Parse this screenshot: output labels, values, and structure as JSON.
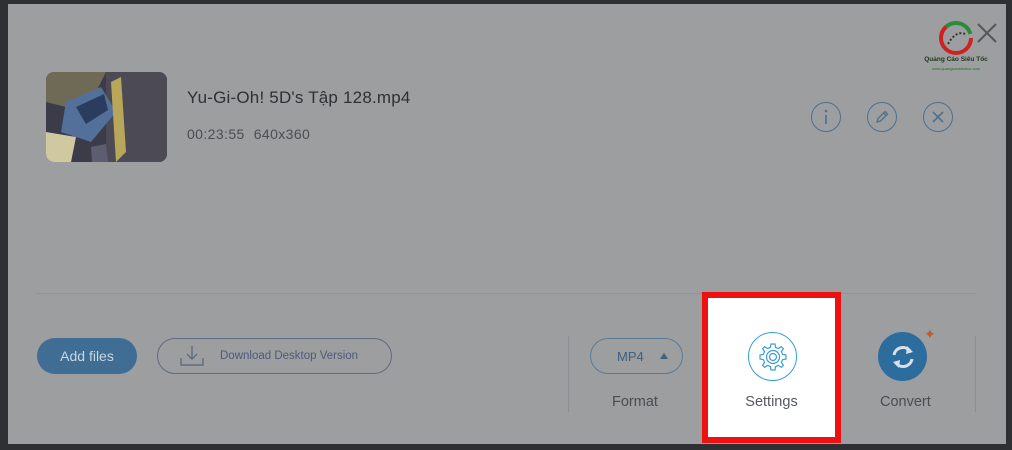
{
  "file": {
    "name": "Yu-Gi-Oh! 5D's Tập 128.mp4",
    "duration": "00:23:55",
    "resolution": "640x360"
  },
  "toolbar": {
    "add_files_label": "Add files",
    "download_label": "Download Desktop Version",
    "format_value": "MP4",
    "format_caption": "Format",
    "settings_label": "Settings",
    "convert_label": "Convert"
  },
  "logo": {
    "brand": "Quảng Cáo Siêu Tốc",
    "tagline": "www.quangcaosieutoc.com"
  },
  "colors": {
    "panel_bg": "#9c9ea0",
    "accent_blue": "#3a9ed6",
    "highlight_red": "#ee1111",
    "add_files_bg": "#3f6d93"
  },
  "icons": {
    "file_actions": [
      "info-icon",
      "edit-icon",
      "remove-icon"
    ],
    "settings": "gear-icon",
    "convert": "refresh-arrows-icon",
    "close": "close-icon",
    "download": "download-tray-icon"
  }
}
